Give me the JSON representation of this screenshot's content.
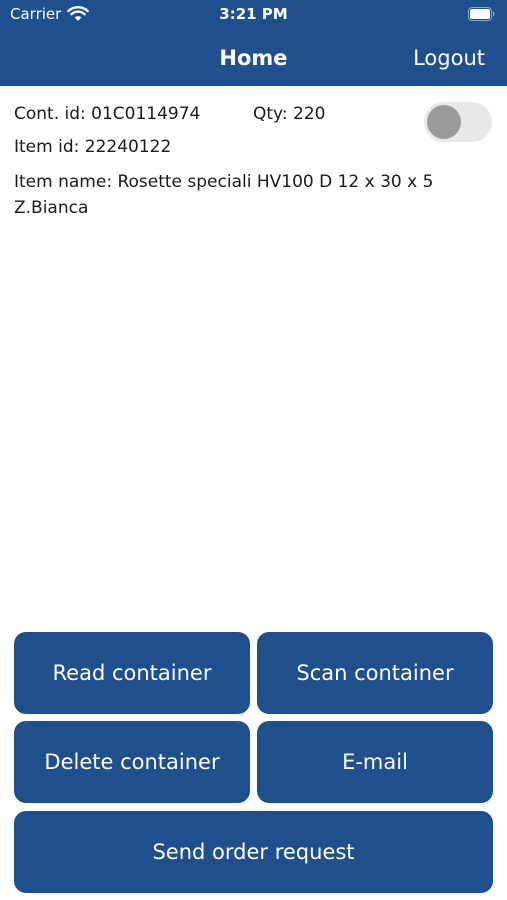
{
  "status_bar": {
    "carrier": "Carrier",
    "time": "3:21 PM"
  },
  "nav": {
    "title": "Home",
    "logout_label": "Logout"
  },
  "container_info": {
    "cont_id": "Cont. id: 01C0114974",
    "qty": "Qty: 220",
    "item_id": "Item id: 22240122",
    "item_name": "Item name: Rosette speciali HV100 D 12 x 30 x 5 Z.Bianca",
    "toggle_on": false
  },
  "buttons": {
    "read_container": "Read container",
    "scan_container": "Scan container",
    "delete_container": "Delete container",
    "email": "E-mail",
    "send_order": "Send order request"
  },
  "colors": {
    "primary": "#1f4f8c",
    "text": "#1a1a1a",
    "toggle_track": "#e8e8e8",
    "toggle_knob": "#9b9b9b"
  },
  "icons": [
    "wifi-icon",
    "battery-icon"
  ]
}
